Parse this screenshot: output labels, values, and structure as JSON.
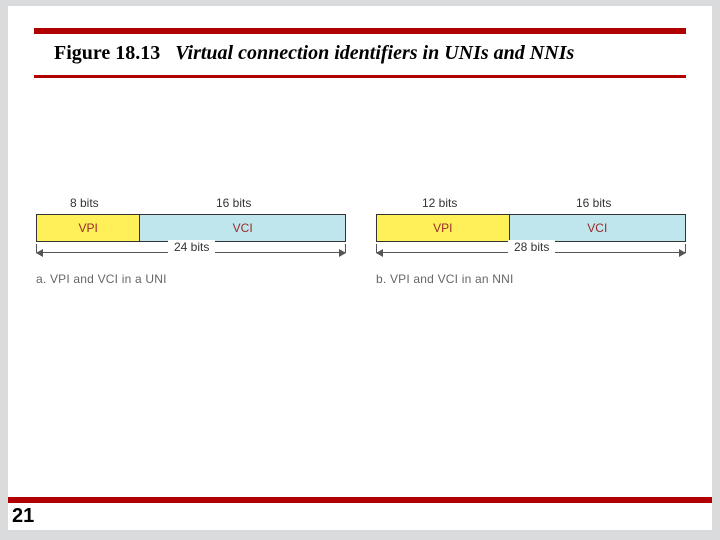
{
  "title": {
    "fig": "Figure 18.13",
    "caption": "Virtual connection identifiers in UNIs and NNIs"
  },
  "page": "21",
  "colors": {
    "rule": "#b00000",
    "vpi": "#fff05a",
    "vci": "#bfe6ec"
  },
  "panels": {
    "a": {
      "vpi_bits": "8 bits",
      "vci_bits": "16 bits",
      "vpi_label": "VPI",
      "vci_label": "VCI",
      "total": "24 bits",
      "caption": "a. VPI and VCI in a UNI"
    },
    "b": {
      "vpi_bits": "12 bits",
      "vci_bits": "16 bits",
      "vpi_label": "VPI",
      "vci_label": "VCI",
      "total": "28 bits",
      "caption": "b. VPI and VCI in an NNI"
    }
  },
  "chart_data": [
    {
      "type": "bar",
      "title": "VPI and VCI in a UNI",
      "categories": [
        "VPI",
        "VCI"
      ],
      "values": [
        8,
        16
      ],
      "xlabel": "",
      "ylabel": "bits",
      "ylim": [
        0,
        24
      ]
    },
    {
      "type": "bar",
      "title": "VPI and VCI in an NNI",
      "categories": [
        "VPI",
        "VCI"
      ],
      "values": [
        12,
        16
      ],
      "xlabel": "",
      "ylabel": "bits",
      "ylim": [
        0,
        28
      ]
    }
  ]
}
